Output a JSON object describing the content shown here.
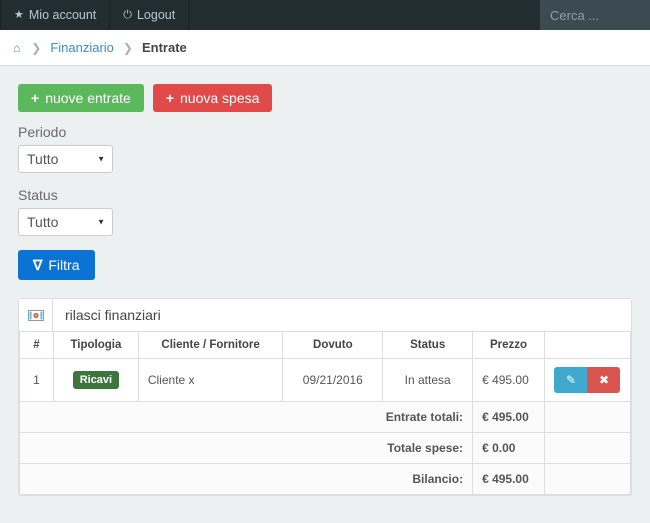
{
  "navbar": {
    "items": [
      {
        "label": "Mio account",
        "icon": "star-icon",
        "glyph": "★"
      },
      {
        "label": "Logout",
        "icon": "power-icon",
        "glyph": "⏻"
      }
    ],
    "search_placeholder": "Cerca ...",
    "search_value": "",
    "background": "#222d32"
  },
  "breadcrumb": {
    "home_icon": "home-icon",
    "home_glyph": "⌂",
    "separator": "❯",
    "parent": "Finanziario",
    "current": "Entrate"
  },
  "actions": {
    "new_income": {
      "label": "nuove entrate",
      "plus": "+",
      "color": "#5cb85c"
    },
    "new_expense": {
      "label": "nuova spesa",
      "plus": "+",
      "color": "#e04b4a"
    }
  },
  "filters": {
    "period_label": "Periodo",
    "period_value": "Tutto",
    "status_label": "Status",
    "status_value": "Tutto",
    "caret": "▼",
    "filter_button": {
      "label": "Filtra",
      "icon": "funnel-icon",
      "glyph": "∇",
      "color": "#0a73d4"
    }
  },
  "panel": {
    "title": "rilasci finanziari",
    "icon": "money-bill-icon",
    "icon_glyph": "▣"
  },
  "table": {
    "headers": {
      "num": "#",
      "tipologia": "Tipologia",
      "cliente": "Cliente / Fornitore",
      "dovuto": "Dovuto",
      "status": "Status",
      "prezzo": "Prezzo",
      "azioni": ""
    },
    "rows": [
      {
        "num": "1",
        "tipologia": "Ricavi",
        "tipologia_color": "#3c763d",
        "cliente": "Cliente x",
        "dovuto": "09/21/2016",
        "status": "In attesa",
        "prezzo": "€ 495.00",
        "edit_icon": "pencil-icon",
        "edit_glyph": "✎",
        "delete_icon": "close-icon",
        "delete_glyph": "✖"
      }
    ],
    "summary": [
      {
        "label": "Entrate totali:",
        "value": "€ 495.00",
        "style": "c-income"
      },
      {
        "label": "Totale spese:",
        "value": "€ 0.00",
        "style": "c-expense"
      },
      {
        "label": "Bilancio:",
        "value": "€ 495.00",
        "style": "c-balance"
      }
    ]
  }
}
